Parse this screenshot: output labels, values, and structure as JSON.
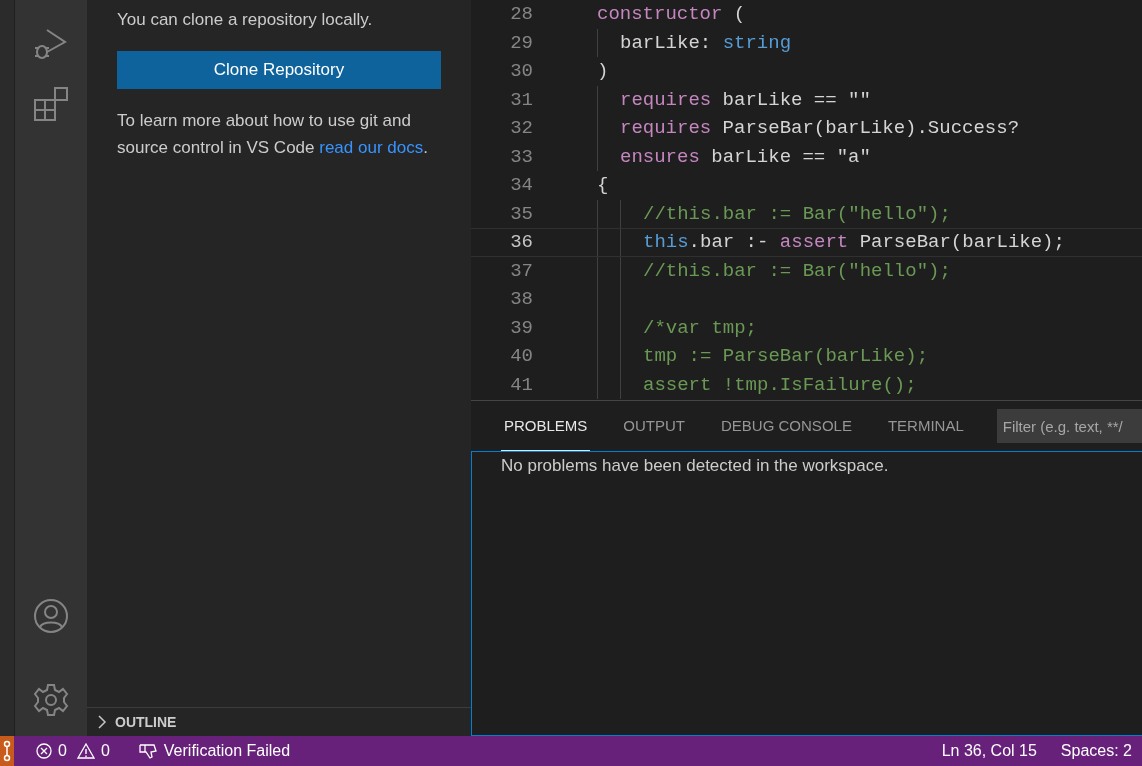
{
  "sidebar": {
    "intro": "You can clone a repository locally.",
    "button": "Clone Repository",
    "help": "To learn more about how to use git and source control in VS Code",
    "link": "read our docs",
    "after": ".",
    "outline": {
      "label": "OUTLINE",
      "expanded": false
    }
  },
  "editor": {
    "lines": [
      {
        "number": "28",
        "current": false,
        "tokens": [
          {
            "kind": "keyword",
            "text": "constructor"
          },
          {
            "kind": "plain",
            "text": " ("
          }
        ],
        "children": [
          {
            "number": "29",
            "current": false,
            "tokens": [
              {
                "kind": "plain",
                "text": "barLike: "
              },
              {
                "kind": "type",
                "text": "string"
              }
            ]
          }
        ]
      },
      {
        "number": "30",
        "current": false,
        "tokens": [
          {
            "kind": "plain",
            "text": ")"
          }
        ],
        "children": [
          {
            "number": "31",
            "current": false,
            "tokens": [
              {
                "kind": "keyword",
                "text": "requires"
              },
              {
                "kind": "plain",
                "text": " barLike == \"\""
              }
            ]
          },
          {
            "number": "32",
            "current": false,
            "tokens": [
              {
                "kind": "keyword",
                "text": "requires"
              },
              {
                "kind": "plain",
                "text": " ParseBar(barLike).Success?"
              }
            ]
          },
          {
            "number": "33",
            "current": false,
            "tokens": [
              {
                "kind": "keyword",
                "text": "ensures"
              },
              {
                "kind": "plain",
                "text": " barLike == \"a\""
              }
            ]
          }
        ]
      },
      {
        "number": "34",
        "current": false,
        "tokens": [
          {
            "kind": "plain",
            "text": "{"
          }
        ],
        "children": [
          {
            "children": [
              {
                "number": "35",
                "current": false,
                "tokens": [
                  {
                    "kind": "comment",
                    "text": "//this.bar := Bar(\"hello\");"
                  }
                ]
              },
              {
                "number": "36",
                "current": true,
                "tokens": [
                  {
                    "kind": "type",
                    "text": "this"
                  },
                  {
                    "kind": "plain",
                    "text": ".bar :- "
                  },
                  {
                    "kind": "keyword",
                    "text": "assert"
                  },
                  {
                    "kind": "plain",
                    "text": " ParseBar(barLike);"
                  }
                ]
              },
              {
                "number": "37",
                "current": false,
                "tokens": [
                  {
                    "kind": "comment",
                    "text": "//this.bar := Bar(\"hello\");"
                  }
                ]
              },
              {
                "number": "38",
                "current": false
              },
              {
                "number": "39",
                "current": false,
                "tokens": [
                  {
                    "kind": "comment",
                    "text": "/*var tmp;"
                  }
                ]
              },
              {
                "number": "40",
                "current": false,
                "tokens": [
                  {
                    "kind": "comment",
                    "text": "tmp := ParseBar(barLike);"
                  }
                ]
              },
              {
                "number": "41",
                "current": false,
                "tokens": [
                  {
                    "kind": "comment",
                    "text": "assert !tmp.IsFailure();"
                  }
                ]
              }
            ]
          }
        ]
      }
    ]
  },
  "panel": {
    "tabs": [
      {
        "label": "PROBLEMS",
        "selected": true
      },
      {
        "label": "OUTPUT",
        "selected": false
      },
      {
        "label": "DEBUG CONSOLE",
        "selected": false
      },
      {
        "label": "TERMINAL",
        "selected": false
      }
    ],
    "filter": {
      "placeholder": "Filter (e.g. text, **/"
    },
    "message": "No problems have been detected in the workspace."
  },
  "status_bar": {
    "errors": "0",
    "warnings": "0",
    "verification": "Verification Failed",
    "position": "Ln 36, Col 15",
    "indentation": "Spaces: 2"
  }
}
